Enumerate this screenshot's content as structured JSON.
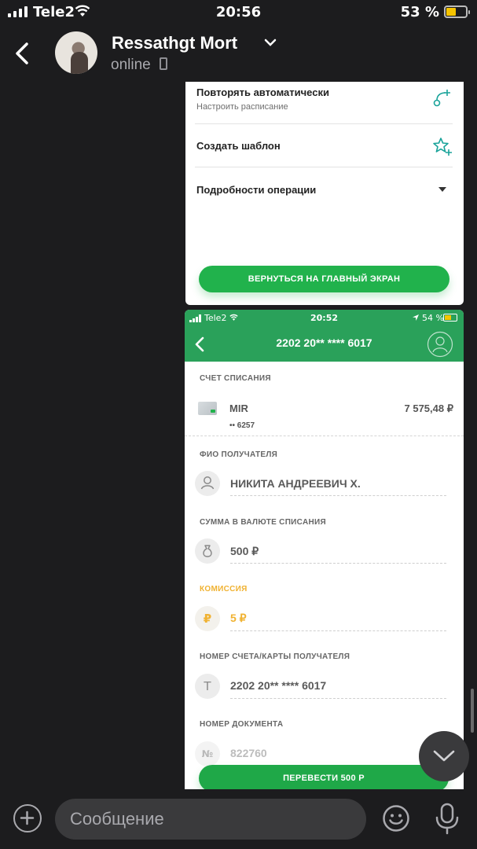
{
  "status_bar": {
    "carrier": "Tele2",
    "time": "20:56",
    "battery": "53 %",
    "battery_level": 0.53
  },
  "chat_header": {
    "name": "Ressathgt Mort",
    "status": "online"
  },
  "receipt_bottom": {
    "repeat_title": "Повторять автоматически",
    "repeat_sub": "Настроить расписание",
    "template_title": "Создать шаблон",
    "details_title": "Подробности операции",
    "home_button": "ВЕРНУТЬСЯ НА ГЛАВНЫЙ ЭКРАН"
  },
  "transfer_screen": {
    "status": {
      "carrier": "Tele2",
      "time": "20:52",
      "battery": "54 %"
    },
    "title": "2202 20** **** 6017",
    "debit_account_label": "СЧЕТ СПИСАНИЯ",
    "card_name": "MIR",
    "card_balance": "7 575,48 ₽",
    "card_number": "•• 6257",
    "recipient_label": "ФИО ПОЛУЧАТЕЛЯ",
    "recipient_name": "НИКИТА АНДРЕЕВИЧ Х.",
    "amount_label": "СУММА В ВАЛЮТЕ СПИСАНИЯ",
    "amount": "500 ₽",
    "commission_label": "КОМИССИЯ",
    "commission": "5 ₽",
    "recipient_card_label": "НОМЕР СЧЕТА/КАРТЫ ПОЛУЧАТЕЛЯ",
    "recipient_card": "2202 20** **** 6017",
    "recipient_card_icon": "T",
    "commission_icon": "₽",
    "document_label": "НОМЕР ДОКУМЕНТА",
    "document_number": "822760",
    "document_icon": "№",
    "transfer_button": "ПЕРЕВЕСТИ 500 Р"
  },
  "composer": {
    "placeholder": "Сообщение"
  },
  "colors": {
    "sber_green": "#21b24c",
    "header_green": "#2aa15a",
    "commission_orange": "#f0b232",
    "dark_bg": "#1c1c1e"
  }
}
